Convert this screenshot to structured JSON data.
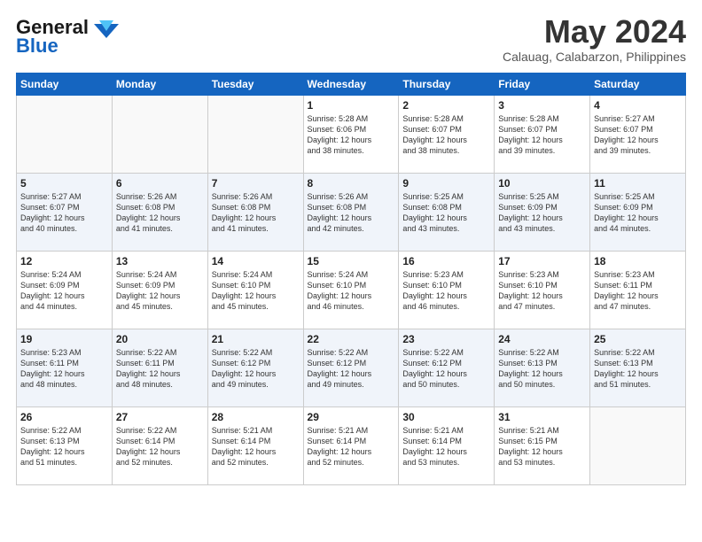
{
  "logo": {
    "line1": "General",
    "line2": "Blue"
  },
  "title": "May 2024",
  "location": "Calauag, Calabarzon, Philippines",
  "days_of_week": [
    "Sunday",
    "Monday",
    "Tuesday",
    "Wednesday",
    "Thursday",
    "Friday",
    "Saturday"
  ],
  "weeks": [
    [
      {
        "day": "",
        "info": ""
      },
      {
        "day": "",
        "info": ""
      },
      {
        "day": "",
        "info": ""
      },
      {
        "day": "1",
        "info": "Sunrise: 5:28 AM\nSunset: 6:06 PM\nDaylight: 12 hours\nand 38 minutes."
      },
      {
        "day": "2",
        "info": "Sunrise: 5:28 AM\nSunset: 6:07 PM\nDaylight: 12 hours\nand 38 minutes."
      },
      {
        "day": "3",
        "info": "Sunrise: 5:28 AM\nSunset: 6:07 PM\nDaylight: 12 hours\nand 39 minutes."
      },
      {
        "day": "4",
        "info": "Sunrise: 5:27 AM\nSunset: 6:07 PM\nDaylight: 12 hours\nand 39 minutes."
      }
    ],
    [
      {
        "day": "5",
        "info": "Sunrise: 5:27 AM\nSunset: 6:07 PM\nDaylight: 12 hours\nand 40 minutes."
      },
      {
        "day": "6",
        "info": "Sunrise: 5:26 AM\nSunset: 6:08 PM\nDaylight: 12 hours\nand 41 minutes."
      },
      {
        "day": "7",
        "info": "Sunrise: 5:26 AM\nSunset: 6:08 PM\nDaylight: 12 hours\nand 41 minutes."
      },
      {
        "day": "8",
        "info": "Sunrise: 5:26 AM\nSunset: 6:08 PM\nDaylight: 12 hours\nand 42 minutes."
      },
      {
        "day": "9",
        "info": "Sunrise: 5:25 AM\nSunset: 6:08 PM\nDaylight: 12 hours\nand 43 minutes."
      },
      {
        "day": "10",
        "info": "Sunrise: 5:25 AM\nSunset: 6:09 PM\nDaylight: 12 hours\nand 43 minutes."
      },
      {
        "day": "11",
        "info": "Sunrise: 5:25 AM\nSunset: 6:09 PM\nDaylight: 12 hours\nand 44 minutes."
      }
    ],
    [
      {
        "day": "12",
        "info": "Sunrise: 5:24 AM\nSunset: 6:09 PM\nDaylight: 12 hours\nand 44 minutes."
      },
      {
        "day": "13",
        "info": "Sunrise: 5:24 AM\nSunset: 6:09 PM\nDaylight: 12 hours\nand 45 minutes."
      },
      {
        "day": "14",
        "info": "Sunrise: 5:24 AM\nSunset: 6:10 PM\nDaylight: 12 hours\nand 45 minutes."
      },
      {
        "day": "15",
        "info": "Sunrise: 5:24 AM\nSunset: 6:10 PM\nDaylight: 12 hours\nand 46 minutes."
      },
      {
        "day": "16",
        "info": "Sunrise: 5:23 AM\nSunset: 6:10 PM\nDaylight: 12 hours\nand 46 minutes."
      },
      {
        "day": "17",
        "info": "Sunrise: 5:23 AM\nSunset: 6:10 PM\nDaylight: 12 hours\nand 47 minutes."
      },
      {
        "day": "18",
        "info": "Sunrise: 5:23 AM\nSunset: 6:11 PM\nDaylight: 12 hours\nand 47 minutes."
      }
    ],
    [
      {
        "day": "19",
        "info": "Sunrise: 5:23 AM\nSunset: 6:11 PM\nDaylight: 12 hours\nand 48 minutes."
      },
      {
        "day": "20",
        "info": "Sunrise: 5:22 AM\nSunset: 6:11 PM\nDaylight: 12 hours\nand 48 minutes."
      },
      {
        "day": "21",
        "info": "Sunrise: 5:22 AM\nSunset: 6:12 PM\nDaylight: 12 hours\nand 49 minutes."
      },
      {
        "day": "22",
        "info": "Sunrise: 5:22 AM\nSunset: 6:12 PM\nDaylight: 12 hours\nand 49 minutes."
      },
      {
        "day": "23",
        "info": "Sunrise: 5:22 AM\nSunset: 6:12 PM\nDaylight: 12 hours\nand 50 minutes."
      },
      {
        "day": "24",
        "info": "Sunrise: 5:22 AM\nSunset: 6:13 PM\nDaylight: 12 hours\nand 50 minutes."
      },
      {
        "day": "25",
        "info": "Sunrise: 5:22 AM\nSunset: 6:13 PM\nDaylight: 12 hours\nand 51 minutes."
      }
    ],
    [
      {
        "day": "26",
        "info": "Sunrise: 5:22 AM\nSunset: 6:13 PM\nDaylight: 12 hours\nand 51 minutes."
      },
      {
        "day": "27",
        "info": "Sunrise: 5:22 AM\nSunset: 6:14 PM\nDaylight: 12 hours\nand 52 minutes."
      },
      {
        "day": "28",
        "info": "Sunrise: 5:21 AM\nSunset: 6:14 PM\nDaylight: 12 hours\nand 52 minutes."
      },
      {
        "day": "29",
        "info": "Sunrise: 5:21 AM\nSunset: 6:14 PM\nDaylight: 12 hours\nand 52 minutes."
      },
      {
        "day": "30",
        "info": "Sunrise: 5:21 AM\nSunset: 6:14 PM\nDaylight: 12 hours\nand 53 minutes."
      },
      {
        "day": "31",
        "info": "Sunrise: 5:21 AM\nSunset: 6:15 PM\nDaylight: 12 hours\nand 53 minutes."
      },
      {
        "day": "",
        "info": ""
      }
    ]
  ]
}
